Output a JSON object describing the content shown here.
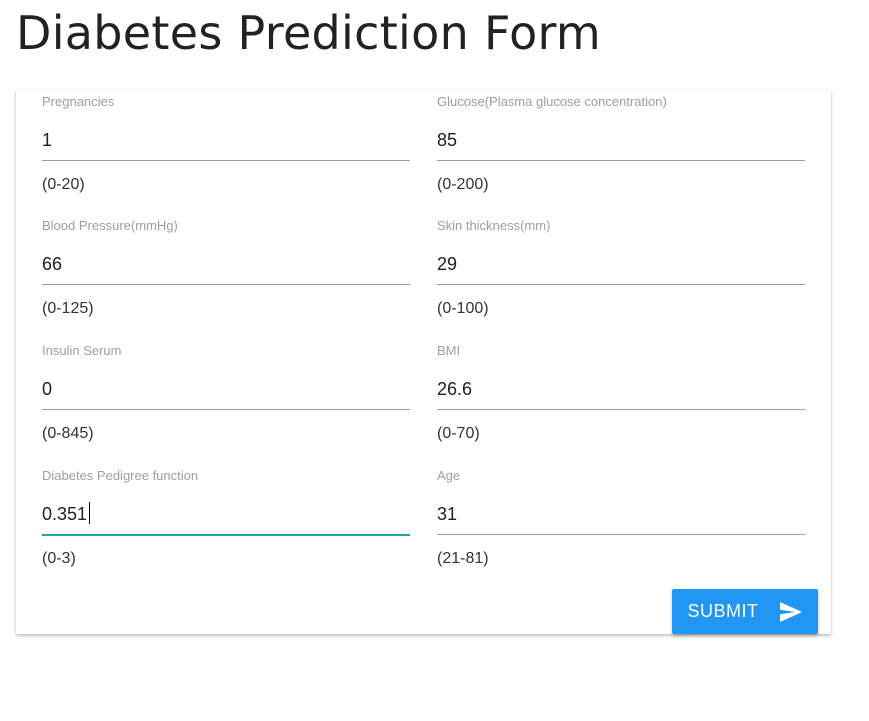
{
  "page": {
    "title": "Diabetes Prediction Form"
  },
  "form": {
    "fields": [
      {
        "label": "Pregnancies",
        "value": "1",
        "hint": "(0-20)"
      },
      {
        "label": "Glucose(Plasma glucose concentration)",
        "value": "85",
        "hint": "(0-200)"
      },
      {
        "label": "Blood Pressure(mmHg)",
        "value": "66",
        "hint": "(0-125)"
      },
      {
        "label": "Skin thickness(mm)",
        "value": "29",
        "hint": "(0-100)"
      },
      {
        "label": "Insulin Serum",
        "value": "0",
        "hint": "(0-845)"
      },
      {
        "label": "BMI",
        "value": "26.6",
        "hint": "(0-70)"
      },
      {
        "label": "Diabetes Pedigree function",
        "value": "0.351",
        "hint": "(0-3)"
      },
      {
        "label": "Age",
        "value": "31",
        "hint": "(21-81)"
      }
    ],
    "submit": {
      "label": "SUBMIT",
      "icon": "send-icon"
    }
  },
  "colors": {
    "accent": "#26a69a",
    "button": "#2196f3"
  }
}
